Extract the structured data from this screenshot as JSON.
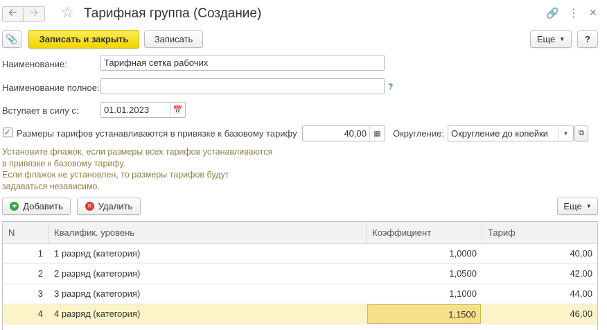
{
  "window": {
    "title": "Тарифная группа (Создание)"
  },
  "toolbar": {
    "save_close_label": "Записать и закрыть",
    "save_label": "Записать",
    "more_label": "Еще",
    "help_label": "?"
  },
  "form": {
    "name_label": "Наименование:",
    "name_value": "Тарифная сетка рабочих",
    "fullname_label": "Наименование полное:",
    "fullname_value": "",
    "fullname_help": "?",
    "date_label": "Вступает в силу с:",
    "date_value": "01.01.2023",
    "base_checkbox_label": "Размеры тарифов устанавливаются в привязке к базовому тарифу",
    "base_checked": true,
    "base_value": "40,00",
    "rounding_label": "Округление:",
    "rounding_value": "Округление до копейки",
    "hint_lines": [
      "Установите флажок, если размеры всех тарифов устанавливаются",
      "в привязке к базовому тарифу.",
      "Если флажок не установлен, то размеры тарифов будут",
      "задаваться независимо."
    ]
  },
  "table_toolbar": {
    "add_label": "Добавить",
    "delete_label": "Удалить",
    "more_label": "Еще"
  },
  "table": {
    "columns": [
      "N",
      "Квалифик. уровень",
      "Коэффициент",
      "Тариф"
    ],
    "rows": [
      {
        "n": "1",
        "level": "1 разряд (категория)",
        "coef": "1,0000",
        "tariff": "40,00"
      },
      {
        "n": "2",
        "level": "2 разряд (категория)",
        "coef": "1,0500",
        "tariff": "42,00"
      },
      {
        "n": "3",
        "level": "3 разряд (категория)",
        "coef": "1,1000",
        "tariff": "44,00"
      },
      {
        "n": "4",
        "level": "4 разряд (категория)",
        "coef": "1,1500",
        "tariff": "46,00"
      }
    ],
    "selected_row": 4
  },
  "colors": {
    "primary_button": "#f3d400",
    "hint_text": "#8f7f47",
    "selected_row": "#fcf3c8",
    "current_cell": "#f7e08a"
  }
}
